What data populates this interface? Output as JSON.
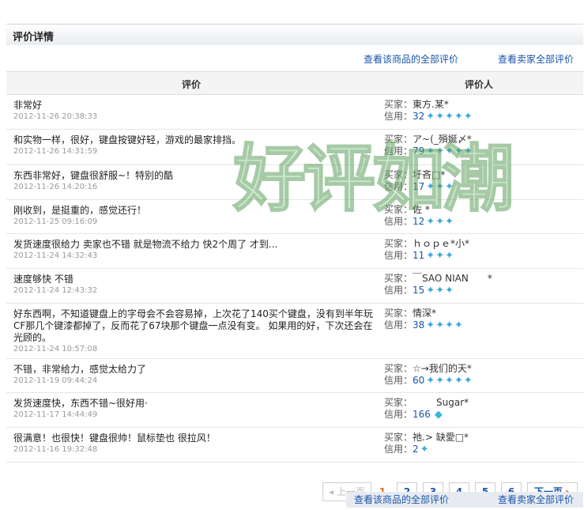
{
  "header": {
    "title": "评价详情"
  },
  "links": {
    "all_product_reviews": "查看该商品的全部评价",
    "all_seller_reviews": "查看卖家全部评价"
  },
  "table": {
    "col_review": "评价",
    "col_reviewer": "评价人",
    "buyer_label": "买家：",
    "credit_label": "信用："
  },
  "rows": [
    {
      "text": "非常好",
      "date": "2012-11-26 20:38:33",
      "buyer": "東方.某*",
      "credit": "32",
      "stars": 5
    },
    {
      "text": "和实物一样，很好，键盘按键好轻，游戏的最家排挡。",
      "date": "2012-11-26 14:31:59",
      "buyer": "ア~(_殞娫〆*",
      "credit": "79",
      "stars": 5
    },
    {
      "text": "东西非常好，键盘很舒服~！特别的酷",
      "date": "2012-11-26 14:20:16",
      "buyer": "圩吝□*",
      "credit": "17",
      "stars": 3
    },
    {
      "text": "刚收到，是挺重的，感觉还行！",
      "date": "2012-11-25 09:16:09",
      "buyer": "佐 *",
      "credit": "12",
      "stars": 3
    },
    {
      "text": "发货速度很给力 卖家也不错 就是物流不给力 快2个周了 才到...",
      "date": "2012-11-24 14:32:43",
      "buyer": "ｈｏｐｅ*小*",
      "credit": "11",
      "stars": 3
    },
    {
      "text": "速度够快 不错",
      "date": "2012-11-24 12:43:32",
      "buyer": "￣SAO NIAN　　*",
      "credit": "15",
      "stars": 3
    },
    {
      "text": "好东西啊，不知道键盘上的字母会不会容易掉，上次花了140买个键盘，没有到半年玩CF那几个键漆都掉了，反而花了67块那个键盘一点没有变。 如果用的好，下次还会在光顾的。",
      "date": "2012-11-24 10:57:08",
      "buyer": "情深*",
      "credit": "38",
      "stars": 4
    },
    {
      "text": "不错，非常给力，感觉太给力了",
      "date": "2012-11-19 09:44:24",
      "buyer": "☆→我们的天*",
      "credit": "60",
      "stars": 5
    },
    {
      "text": "发货速度快，东西不错~很好用·",
      "date": "2012-11-17 14:44:49",
      "buyer": "　　　Sugar*",
      "credit": "166",
      "stars": 0,
      "diamond": true
    },
    {
      "text": "很满意！也很快！键盘很帅！鼠标垫也 很拉风！",
      "date": "2012-11-16 19:32:48",
      "buyer": "祂.> 缺愛□*",
      "credit": "2",
      "stars": 1
    }
  ],
  "pager": {
    "prev": "上一页",
    "current": "1",
    "pages": [
      "2",
      "3",
      "4",
      "5",
      "6"
    ],
    "next": "下一页"
  },
  "watermark": "好评如潮",
  "icons": {
    "star": "star-icon",
    "diamond": "diamond-icon",
    "accent": "#1a55a8",
    "current_page": "#e06d1a"
  }
}
